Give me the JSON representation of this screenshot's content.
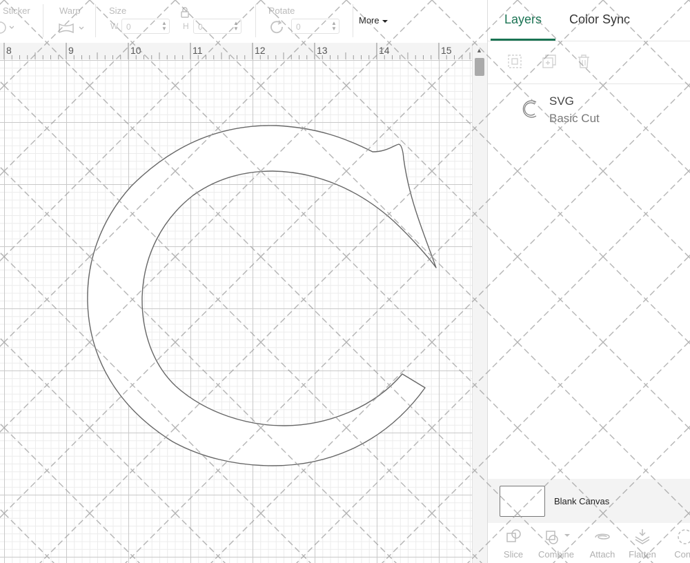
{
  "toolbar": {
    "sticker_label": "Sticker",
    "warp_label": "Warp",
    "size_label": "Size",
    "rotate_label": "Rotate",
    "width_prefix": "W",
    "height_prefix": "H",
    "width_value": "0",
    "height_value": "0",
    "rotate_value": "0",
    "more_label": "More"
  },
  "ruler": {
    "ticks": [
      "8",
      "9",
      "10",
      "11",
      "12",
      "13",
      "14",
      "15"
    ]
  },
  "panel": {
    "tabs": [
      {
        "label": "Layers",
        "active": true
      },
      {
        "label": "Color Sync",
        "active": false
      }
    ],
    "layer": {
      "name": "SVG",
      "operation": "Basic Cut"
    },
    "blank_canvas_label": "Blank Canvas",
    "actions": [
      {
        "label": "Slice",
        "icon": "slice-icon"
      },
      {
        "label": "Combine",
        "icon": "combine-icon"
      },
      {
        "label": "Attach",
        "icon": "attach-icon"
      },
      {
        "label": "Flatten",
        "icon": "flatten-icon"
      },
      {
        "label": "Cont",
        "icon": "contour-icon"
      }
    ]
  },
  "colors": {
    "accent": "#1a7353",
    "grid_major": "#c9c9c9",
    "grid_minor": "#ececec"
  }
}
